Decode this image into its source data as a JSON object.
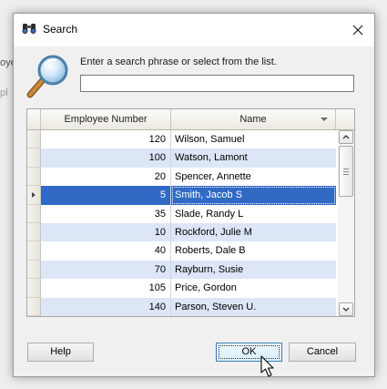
{
  "background": {
    "fragments": [
      "oye",
      "pl"
    ]
  },
  "dialog": {
    "title": "Search",
    "title_icon": "binoculars-icon",
    "close_icon": "close-icon",
    "prompt": "Enter a search phrase or select from the list.",
    "search": {
      "value": "",
      "placeholder": ""
    },
    "icon": "magnifier-icon"
  },
  "grid": {
    "columns": [
      "Employee Number",
      "Name"
    ],
    "rows": [
      {
        "number": "120",
        "name": "Wilson, Samuel",
        "selected": false
      },
      {
        "number": "100",
        "name": "Watson, Lamont",
        "selected": false
      },
      {
        "number": "20",
        "name": "Spencer, Annette",
        "selected": false
      },
      {
        "number": "5",
        "name": "Smith, Jacob S",
        "selected": true
      },
      {
        "number": "35",
        "name": "Slade, Randy L",
        "selected": false
      },
      {
        "number": "10",
        "name": "Rockford, Julie M",
        "selected": false
      },
      {
        "number": "40",
        "name": "Roberts, Dale B",
        "selected": false
      },
      {
        "number": "70",
        "name": "Rayburn, Susie",
        "selected": false
      },
      {
        "number": "105",
        "name": "Price, Gordon",
        "selected": false
      },
      {
        "number": "140",
        "name": "Parson, Steven U.",
        "selected": false
      }
    ]
  },
  "buttons": {
    "help": "Help",
    "ok": "OK",
    "cancel": "Cancel"
  },
  "colors": {
    "selection": "#316ac5",
    "alt_row": "#dce6f7",
    "ok_border": "#3c7fb1"
  }
}
